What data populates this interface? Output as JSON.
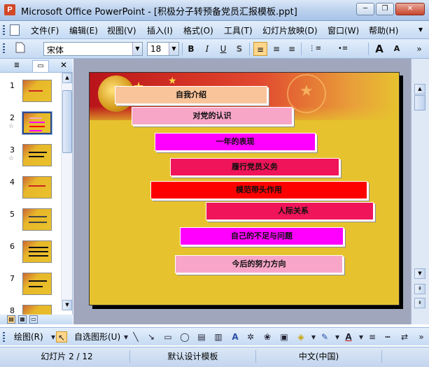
{
  "window": {
    "title": "Microsoft Office PowerPoint - [积极分子转预备党员汇报模板.ppt]",
    "app_icon": "P",
    "controls": {
      "minimize": "─",
      "restore": "❐",
      "close": "✕"
    }
  },
  "menu": {
    "items": [
      "文件(F)",
      "编辑(E)",
      "视图(V)",
      "插入(I)",
      "格式(O)",
      "工具(T)",
      "幻灯片放映(D)",
      "窗口(W)",
      "帮助(H)"
    ],
    "overflow": "▾"
  },
  "toolbar": {
    "new_doc_icon": "new-document-icon",
    "font_name": "宋体",
    "font_size": "18",
    "bold": "B",
    "italic": "I",
    "underline": "U",
    "shadow": "S",
    "align_left": "≡",
    "align_center": "≡",
    "align_right": "≡",
    "numbered_list": "⋮≡",
    "bulleted_list": "•≡",
    "grow_font": "A",
    "shrink_font": "A",
    "overflow": "»"
  },
  "pane": {
    "tab_outline": "≣",
    "tab_slides": "▭",
    "close": "✕",
    "thumbnails": [
      {
        "num": "1",
        "star": ""
      },
      {
        "num": "2",
        "star": "☆"
      },
      {
        "num": "3",
        "star": "☆"
      },
      {
        "num": "4",
        "star": ""
      },
      {
        "num": "5",
        "star": ""
      },
      {
        "num": "6",
        "star": ""
      },
      {
        "num": "7",
        "star": ""
      },
      {
        "num": "8",
        "star": ""
      }
    ],
    "selected": 2
  },
  "slide": {
    "items": [
      {
        "label": "自我介绍",
        "color": "#f9c49a"
      },
      {
        "label": "对党的认识",
        "color": "#f7a6c8"
      },
      {
        "label": "一年的表现",
        "color": "#ff00ff"
      },
      {
        "label": "履行党员义务",
        "color": "#f0145a"
      },
      {
        "label": "模范带头作用",
        "color": "#ff0000"
      },
      {
        "label": "人际关系",
        "color": "#f0145a"
      },
      {
        "label": "自己的不足与问题",
        "color": "#ff00ff"
      },
      {
        "label": "今后的努力方向",
        "color": "#f7a6c8"
      }
    ]
  },
  "drawing": {
    "draw_menu": "绘图(R)",
    "autoshapes_menu": "自选图形(U)"
  },
  "status": {
    "slide_info": "幻灯片 2 / 12",
    "design": "默认设计模板",
    "language": "中文(中国)"
  }
}
